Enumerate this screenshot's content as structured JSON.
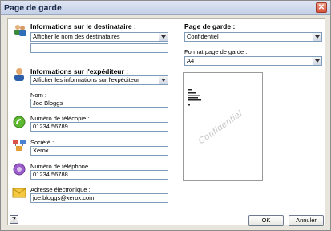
{
  "window": {
    "title": "Page de garde"
  },
  "recipient": {
    "heading": "Informations sur le destinataire :",
    "select_value": "Afficher le nom des destinataires",
    "field_value": ""
  },
  "sender": {
    "heading": "Informations sur l'expéditeur :",
    "select_value": "Afficher les informations sur l'expéditeur"
  },
  "fields": {
    "name_label": "Nom :",
    "name_value": "Joe Bloggs",
    "fax_label": "Numéro de télécopie :",
    "fax_value": "01234 56789",
    "company_label": "Société :",
    "company_value": "Xerox",
    "phone_label": "Numéro de téléphone :",
    "phone_value": "01234 56788",
    "email_label": "Adresse électronique :",
    "email_value": "joe.bloggs@xerox.com"
  },
  "cover_page": {
    "heading": "Page de garde :",
    "select_value": "Confidentiel",
    "format_label": "Format page de garde :",
    "format_value": "A4",
    "watermark": "Confidentiel"
  },
  "buttons": {
    "ok": "OK",
    "cancel": "Annuler",
    "help": "?"
  },
  "colors": {
    "title_bg": "#c3cfe6",
    "field_border": "#7f9db9",
    "close_bg": "#d8533b"
  }
}
